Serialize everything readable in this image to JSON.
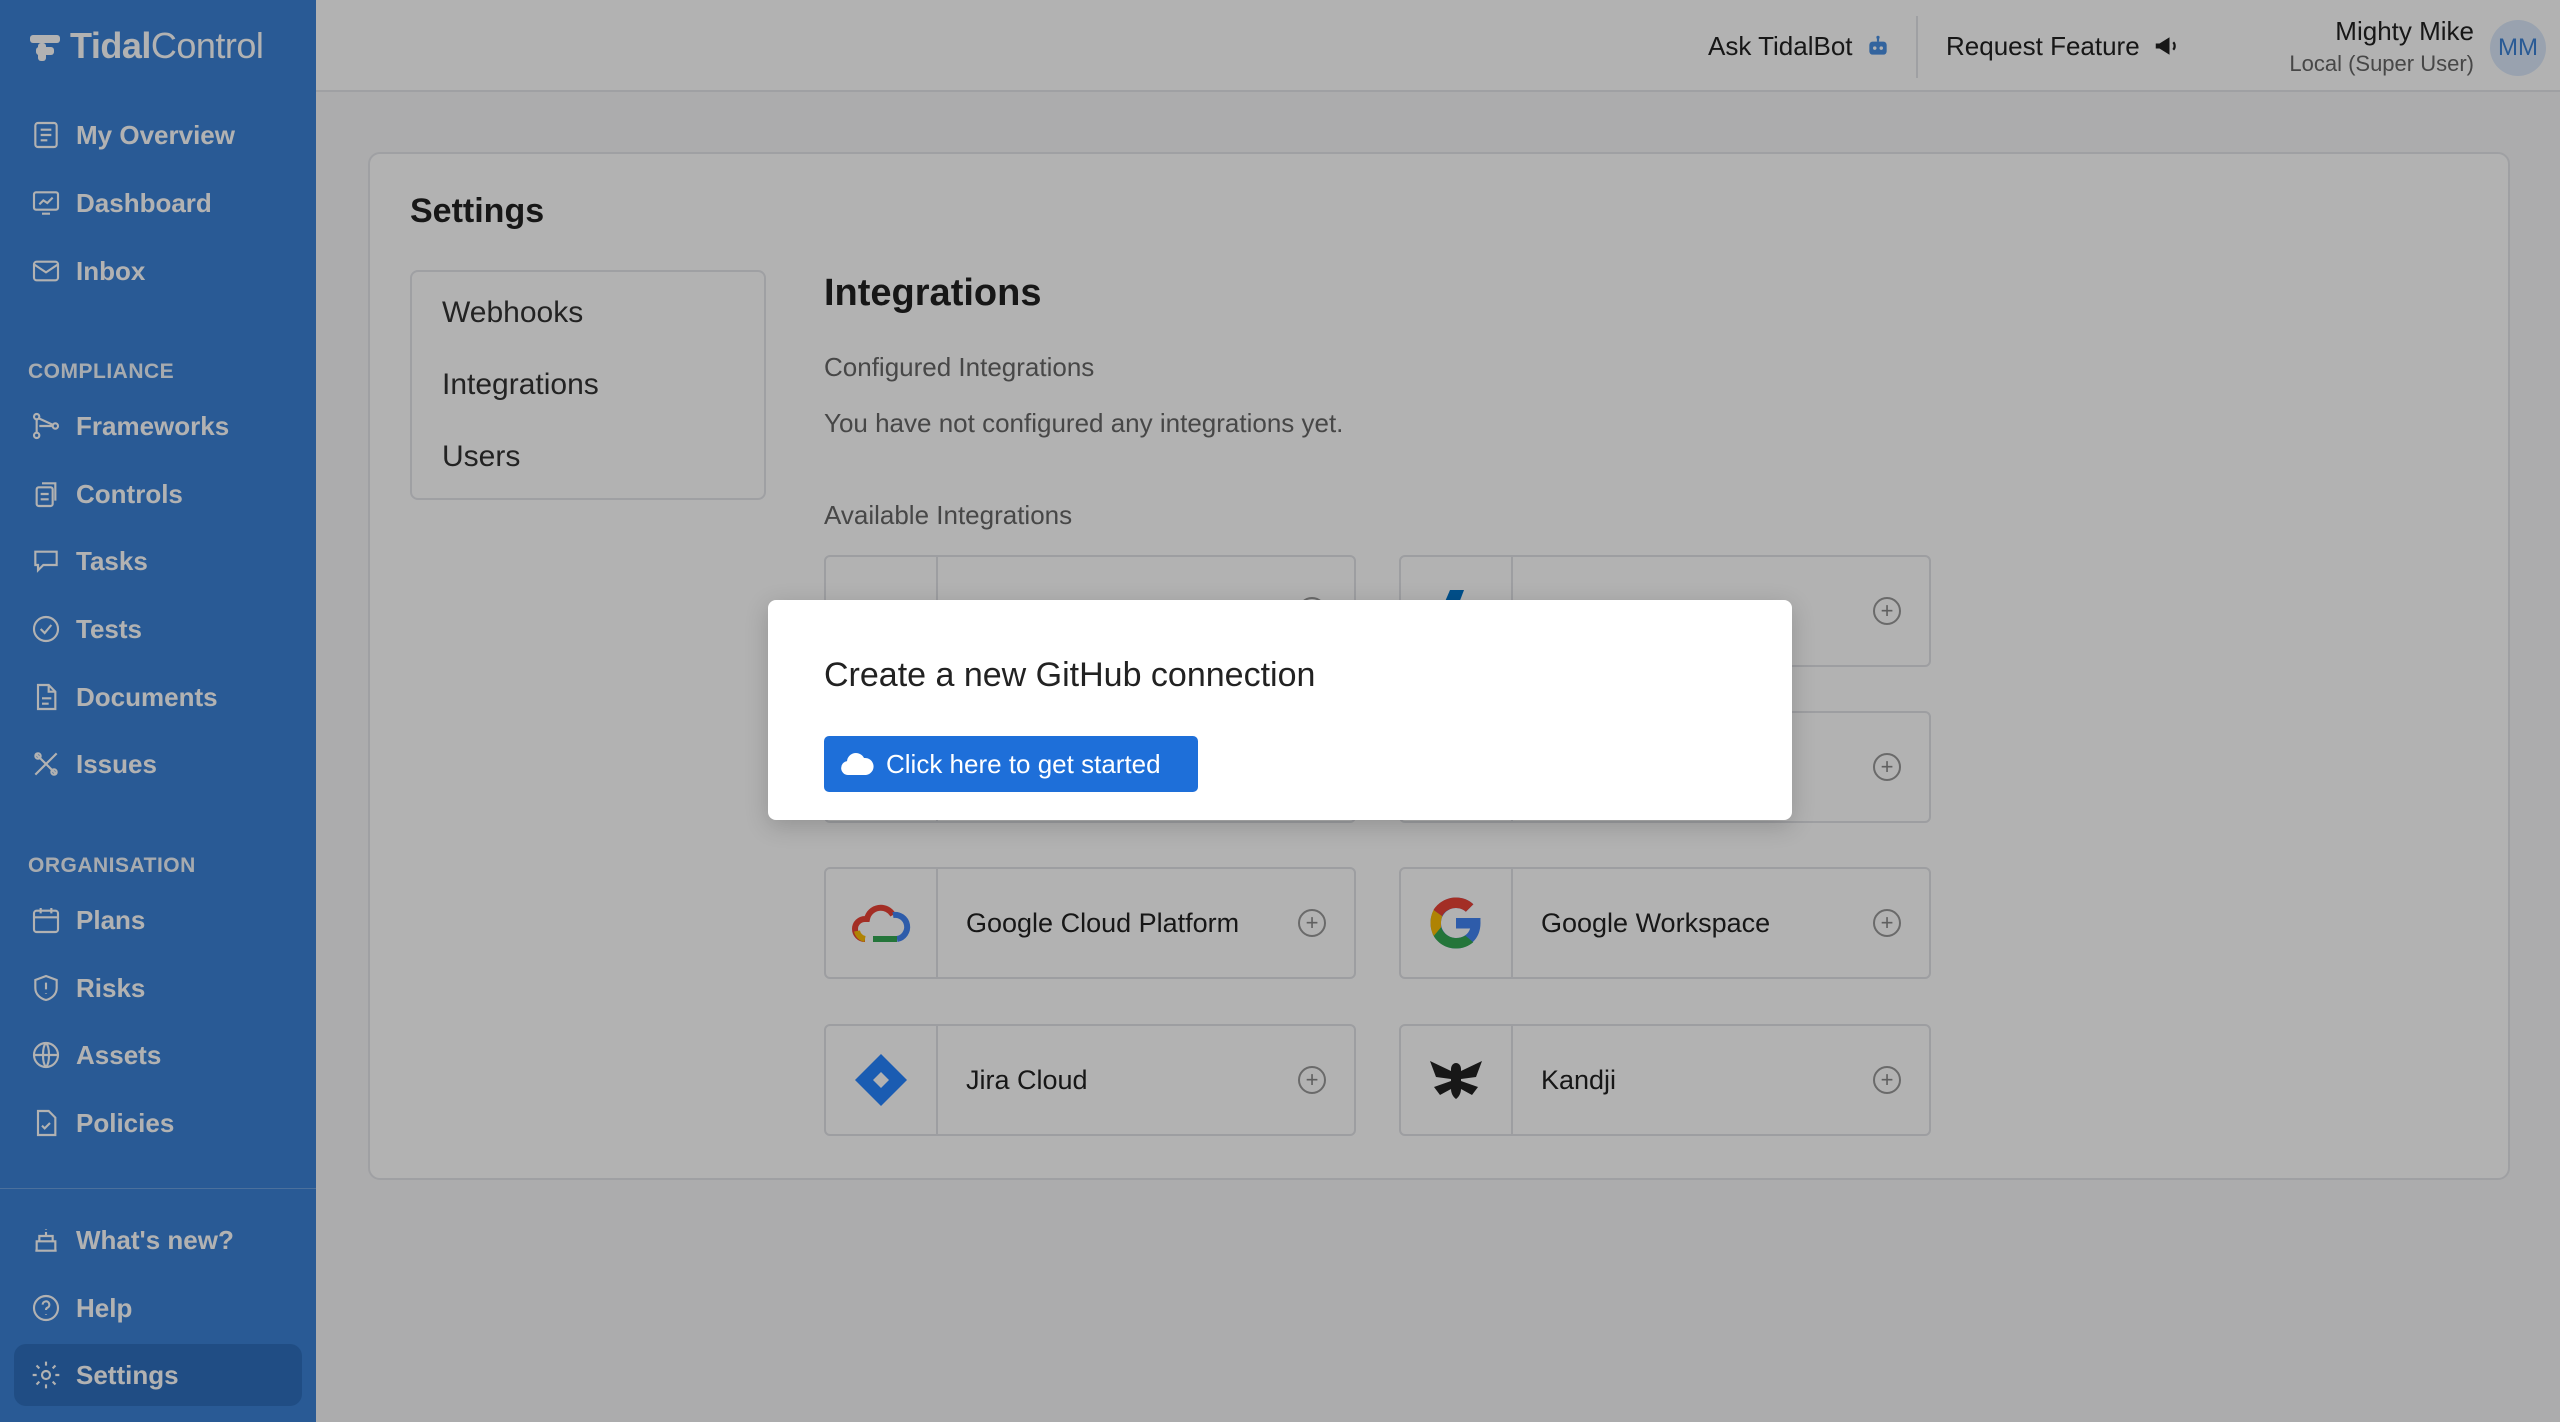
{
  "brand": {
    "name_bold": "Tidal",
    "name_light": "Control"
  },
  "sidebar": {
    "main": [
      {
        "label": "My Overview",
        "icon": "overview-icon"
      },
      {
        "label": "Dashboard",
        "icon": "dashboard-icon"
      },
      {
        "label": "Inbox",
        "icon": "inbox-icon"
      }
    ],
    "compliance_heading": "COMPLIANCE",
    "compliance": [
      {
        "label": "Frameworks",
        "icon": "frameworks-icon"
      },
      {
        "label": "Controls",
        "icon": "controls-icon"
      },
      {
        "label": "Tasks",
        "icon": "tasks-icon"
      },
      {
        "label": "Tests",
        "icon": "tests-icon"
      },
      {
        "label": "Documents",
        "icon": "documents-icon"
      },
      {
        "label": "Issues",
        "icon": "issues-icon"
      }
    ],
    "organisation_heading": "ORGANISATION",
    "organisation": [
      {
        "label": "Plans",
        "icon": "plans-icon"
      },
      {
        "label": "Risks",
        "icon": "risks-icon"
      },
      {
        "label": "Assets",
        "icon": "assets-icon"
      },
      {
        "label": "Policies",
        "icon": "policies-icon"
      }
    ],
    "bottom": [
      {
        "label": "What's new?",
        "icon": "cake-icon"
      },
      {
        "label": "Help",
        "icon": "help-icon"
      },
      {
        "label": "Settings",
        "icon": "gear-icon",
        "active": true
      }
    ]
  },
  "topbar": {
    "ask_label": "Ask TidalBot",
    "request_label": "Request Feature",
    "user_name": "Mighty Mike",
    "user_role": "Local (Super User)",
    "avatar_initials": "MM"
  },
  "settings": {
    "title": "Settings",
    "menu": [
      "Webhooks",
      "Integrations",
      "Users"
    ],
    "section_title": "Integrations",
    "configured_heading": "Configured Integrations",
    "configured_empty": "You have not configured any integrations yet.",
    "available_heading": "Available Integrations",
    "integrations": [
      {
        "name": "",
        "logo": "aws-logo"
      },
      {
        "name": "",
        "logo": "azure-logo"
      },
      {
        "name": "",
        "logo": "github-logo"
      },
      {
        "name": "",
        "logo": "gitlab-logo"
      },
      {
        "name": "Google Cloud Platform",
        "logo": "gcp-logo"
      },
      {
        "name": "Google Workspace",
        "logo": "google-logo"
      },
      {
        "name": "Jira Cloud",
        "logo": "jira-logo"
      },
      {
        "name": "Kandji",
        "logo": "kandji-logo"
      }
    ]
  },
  "modal": {
    "title": "Create a new GitHub connection",
    "button_label": "Click here to get started"
  },
  "colors": {
    "sidebar": "#3b82d6",
    "primary_button": "#1e6fd9"
  }
}
